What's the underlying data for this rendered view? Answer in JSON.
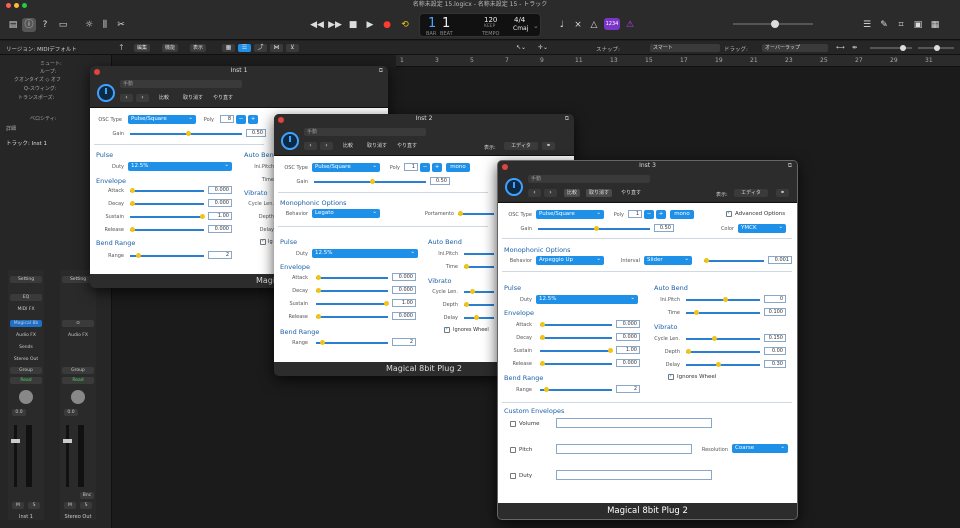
{
  "titlebar": {
    "title": "名称未設定 15.logicx - 名称未設定 15 - トラック"
  },
  "lcd": {
    "bar": "1",
    "beat": "1",
    "tempo": "120",
    "tempo_sub": "KEEP",
    "sig": "4/4",
    "key": "Cmaj",
    "bar_l": "BAR",
    "beat_l": "BEAT",
    "tempo_l": "TEMPO"
  },
  "toolbar": {
    "badge": "1234"
  },
  "arrange": {
    "region_label": "リージョン: MIDIデフォルト",
    "edit": "編集",
    "func": "機能",
    "view": "表示",
    "snap_label": "スナップ:",
    "snap": "スマート",
    "drag_label": "ドラッグ:",
    "drag": "オーバーラップ"
  },
  "inspector": {
    "rows": [
      "ミュート:",
      "ループ:",
      "クオンタイズ ◇ オフ",
      "Q-スウィング:",
      "トランスポーズ:",
      "ベロシティ:"
    ],
    "detail": "詳細",
    "track": "トラック: Inst 1"
  },
  "ruler": [
    "1",
    "3",
    "5",
    "7",
    "9",
    "11",
    "13",
    "15",
    "17",
    "19",
    "21",
    "23",
    "25",
    "27",
    "29",
    "31"
  ],
  "strips": [
    {
      "setting": "Setting",
      "eq": "EQ",
      "midi": "MIDI FX",
      "inst": "Magical 8b",
      "audio": "Audio FX",
      "sends": "Sends",
      "out": "Stereo Out",
      "group": "Group",
      "read": "Read",
      "vol": "0.0",
      "m": "M",
      "s": "S",
      "name": "Inst 1"
    },
    {
      "setting": "Setting",
      "eq": "",
      "midi": "",
      "inst": "",
      "audio": "Audio FX",
      "sends": "",
      "out": "",
      "group": "Group",
      "read": "Read",
      "vol": "0.0",
      "m": "M",
      "s": "S",
      "bnc": "Bnc",
      "name": "Stereo Out"
    }
  ],
  "common": {
    "preset": "手動",
    "compare": "比較",
    "undo": "取り消す",
    "redo": "やり直す",
    "view_label": "表示:",
    "view": "エディタ",
    "footer": "Magical 8bit Plug 2"
  },
  "win1": {
    "title": "Inst 1",
    "osc_type_label": "OSC Type",
    "osc_type": "Pulse/Square",
    "poly_label": "Poly",
    "poly": "8",
    "gain_label": "Gain",
    "gain": "0.50",
    "pulse": "Pulse",
    "duty_label": "Duty",
    "duty": "12.5%",
    "envelope": "Envelope",
    "attack": "Attack",
    "attack_v": "0.000",
    "decay": "Decay",
    "decay_v": "0.000",
    "sustain": "Sustain",
    "sustain_v": "1.00",
    "release": "Release",
    "release_v": "0.000",
    "bend_range": "Bend Range",
    "range_label": "Range",
    "range": "2",
    "auto_bend": "Auto Bend",
    "ini_pitch": "Ini.Pitch",
    "time": "Time",
    "vibrato": "Vibrato",
    "cycle": "Cycle Len.",
    "depth": "Depth",
    "delay": "Delay",
    "ignores": "Ig"
  },
  "win2": {
    "title": "Inst 2",
    "osc_type_label": "OSC Type",
    "osc_type": "Pulse/Square",
    "poly_label": "Poly",
    "poly": "1",
    "mono": "mono",
    "gain_label": "Gain",
    "gain": "0.50",
    "mono_opts": "Monophonic Options",
    "behavior_label": "Behavior",
    "behavior": "Legato",
    "portamento": "Portamento",
    "pulse": "Pulse",
    "duty_label": "Duty",
    "duty": "12.5%",
    "envelope": "Envelope",
    "attack": "Attack",
    "attack_v": "0.000",
    "decay": "Decay",
    "decay_v": "0.000",
    "sustain": "Sustain",
    "sustain_v": "1.00",
    "release": "Release",
    "release_v": "0.000",
    "bend_range": "Bend Range",
    "range_label": "Range",
    "range": "2",
    "auto_bend": "Auto Bend",
    "ini_pitch": "Ini.Pitch",
    "time": "Time",
    "vibrato": "Vibrato",
    "cycle": "Cycle Len.",
    "depth": "Depth",
    "delay": "Delay",
    "ignores": "Ignores Wheel"
  },
  "win3": {
    "title": "Inst 3",
    "osc_type_label": "OSC Type",
    "osc_type": "Pulse/Square",
    "poly_label": "Poly",
    "poly": "1",
    "mono": "mono",
    "adv": "Advanced Options",
    "gain_label": "Gain",
    "gain": "0.50",
    "color_label": "Color",
    "color": "YMCK",
    "mono_opts": "Monophonic Options",
    "behavior_label": "Behavior",
    "behavior": "Arpeggio Up",
    "interval_label": "Interval",
    "interval": "Slider",
    "interval_v": "0.001",
    "pulse": "Pulse",
    "duty_label": "Duty",
    "duty": "12.5%",
    "envelope": "Envelope",
    "attack": "Attack",
    "attack_v": "0.000",
    "decay": "Decay",
    "decay_v": "0.000",
    "sustain": "Sustain",
    "sustain_v": "1.00",
    "release": "Release",
    "release_v": "0.000",
    "bend_range": "Bend Range",
    "range_label": "Range",
    "range": "2",
    "auto_bend": "Auto Bend",
    "ini_pitch": "Ini.Pitch",
    "ini_pitch_v": "0",
    "time": "Time",
    "time_v": "0.100",
    "vibrato": "Vibrato",
    "cycle": "Cycle Len.",
    "cycle_v": "0.150",
    "depth": "Depth",
    "depth_v": "0.00",
    "delay": "Delay",
    "delay_v": "0.30",
    "ignores": "Ignores Wheel",
    "custom": "Custom Envelopes",
    "volume": "Volume",
    "pitch": "Pitch",
    "resolution_label": "Resolution",
    "resolution": "Coarse",
    "duty2": "Duty"
  }
}
